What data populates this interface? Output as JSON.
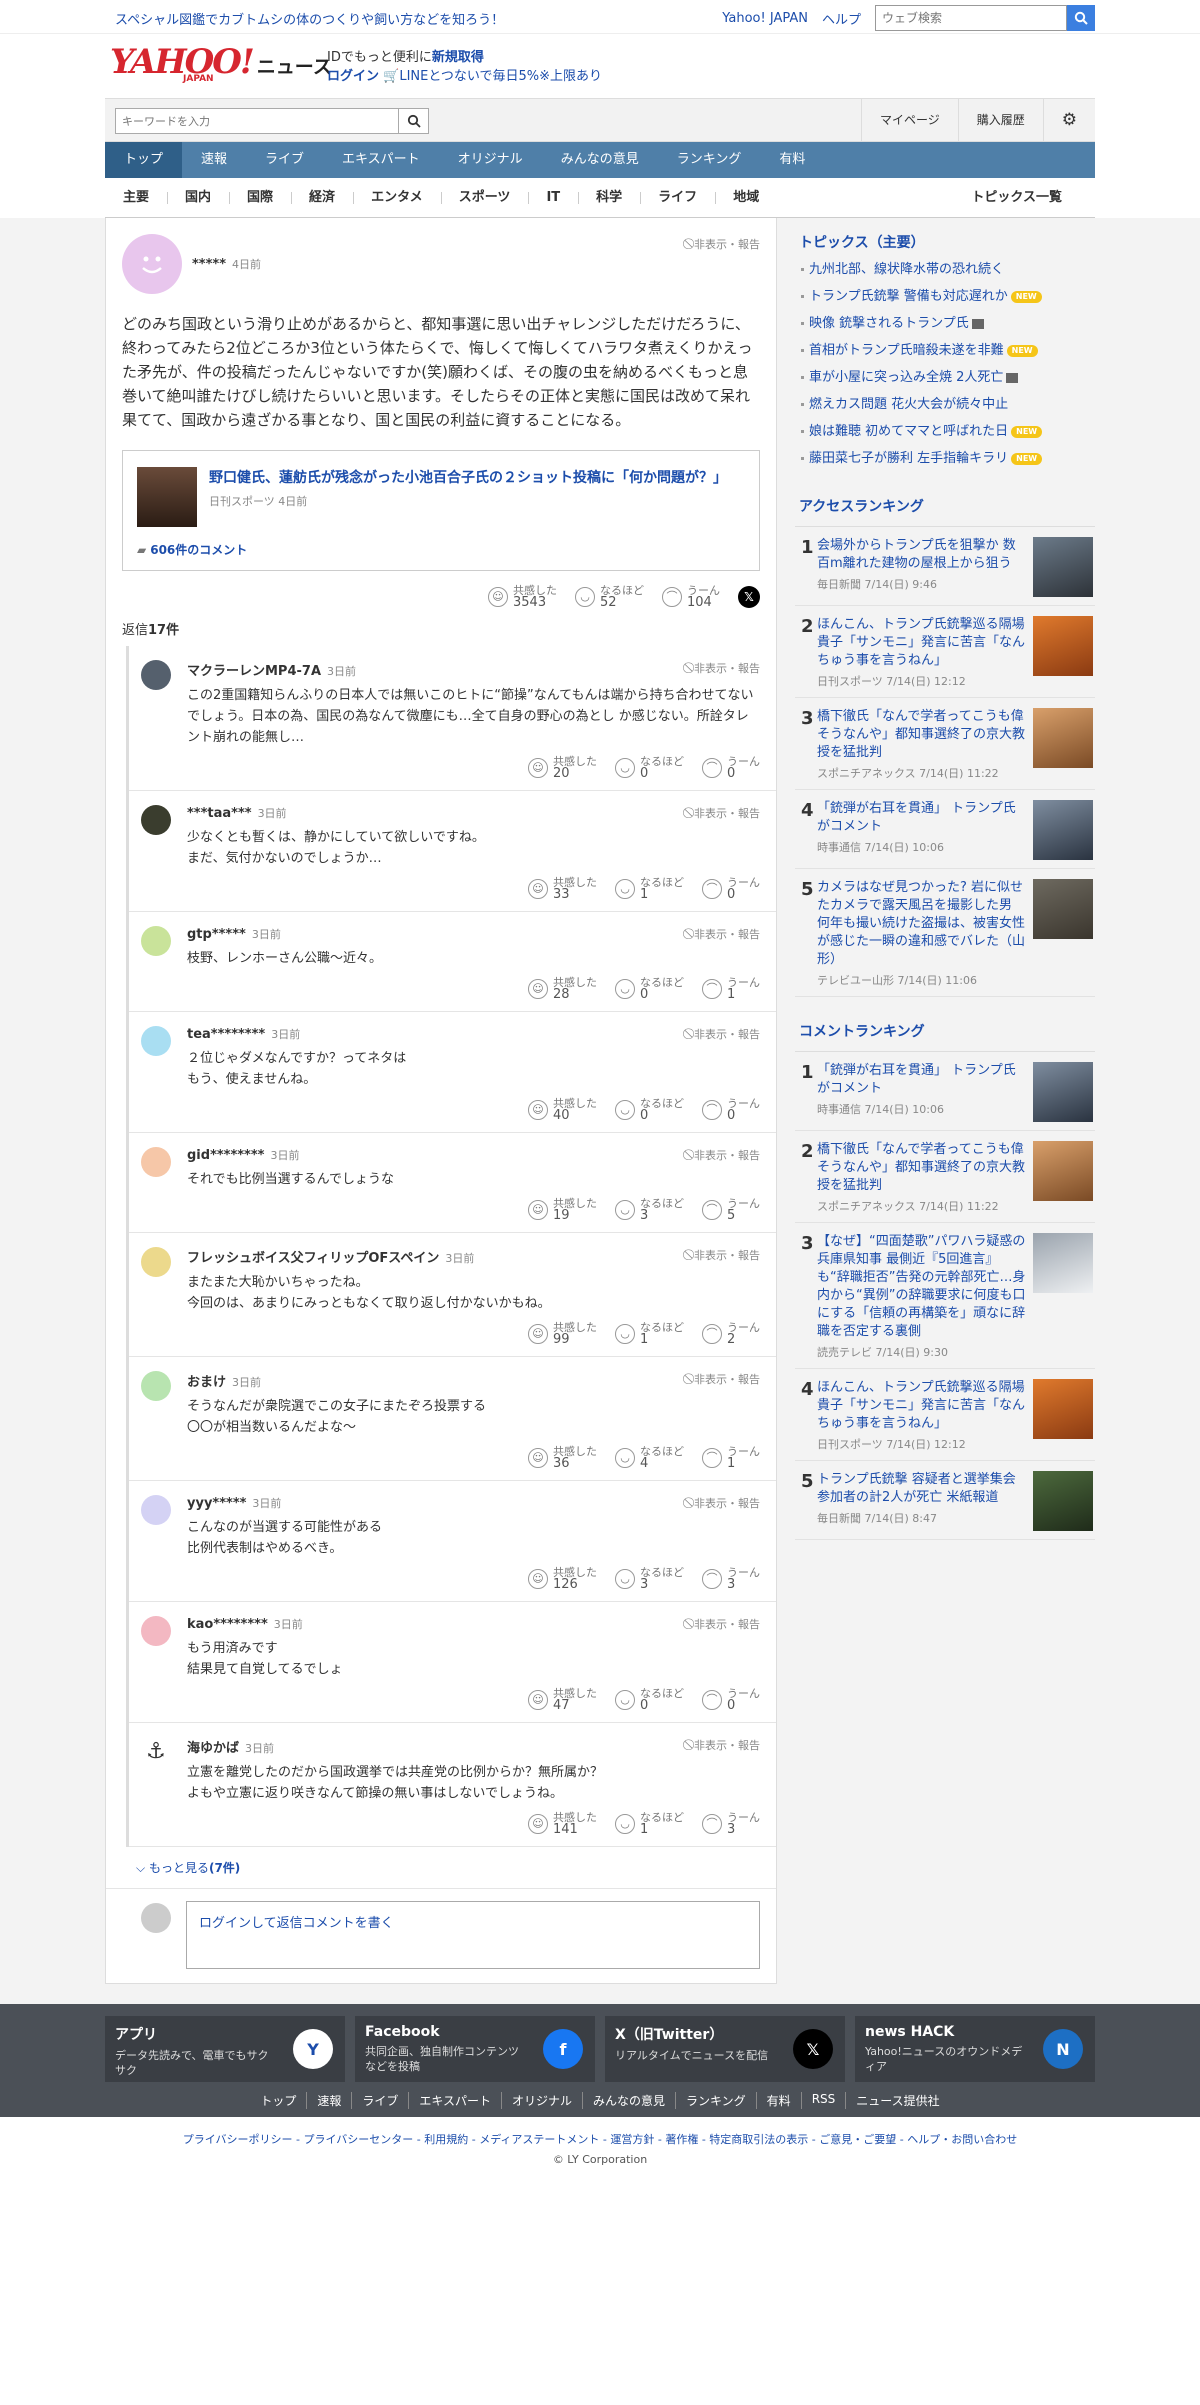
{
  "topbar": {
    "promo": "スペシャル図鑑でカブトムシの体のつくりや飼い方などを知ろう！",
    "yahoo_japan": "Yahoo! JAPAN",
    "help": "ヘルプ",
    "web_search_placeholder": "ウェブ検索"
  },
  "header": {
    "logo": "YAHOO!",
    "logo_sub": "JAPAN",
    "service": "ニュース",
    "id_line1_prefix": "IDでもっと便利に",
    "id_line1_link": "新規取得",
    "login": "ログイン",
    "line_promo": "LINEとつないで毎日5%※上限あり"
  },
  "search": {
    "placeholder": "キーワードを入力",
    "mypage": "マイページ",
    "purchase": "購入履歴"
  },
  "gnav": [
    "トップ",
    "速報",
    "ライブ",
    "エキスパート",
    "オリジナル",
    "みんなの意見",
    "ランキング",
    "有料"
  ],
  "subnav": [
    "主要",
    "国内",
    "国際",
    "経済",
    "エンタメ",
    "スポーツ",
    "IT",
    "科学",
    "ライフ",
    "地域"
  ],
  "subnav_all": "トピックス一覧",
  "comment": {
    "user": "*****",
    "time": "4日前",
    "hide": "非表示・報告",
    "body": "どのみち国政という滑り止めがあるからと、都知事選に思い出チャレンジしただけだろうに、終わってみたら2位どころか3位という体たらくで、悔しくて悔しくてハラワタ煮えくりかえった矛先が、件の投稿だったんじゃないですか(笑)願わくば、その腹の虫を納めるべくもっと息巻いて絶叫誰たけびし続けたらいいと思います。そしたらその正体と実態に国民は改めて呆れ果てて、国政から遠ざかる事となり、国と国民の利益に資することになる。",
    "article_title": "野口健氏、蓮舫氏が残念がった小池百合子氏の２ショット投稿に「何か問題が？」",
    "article_source": "日刊スポーツ 4日前",
    "article_comments": "606件のコメント",
    "react": {
      "l1": "共感した",
      "v1": "3543",
      "l2": "なるほど",
      "v2": "52",
      "l3": "うーん",
      "v3": "104"
    },
    "replies_prefix": "返信",
    "replies_count": "17件"
  },
  "replies": [
    {
      "user": "マクラーレンMP4-7A",
      "time": "3日前",
      "body": "この2重国籍知らんふりの日本人では無いこのヒトに“節操”なんてもんは端から持ち合わせてないでしょう。日本の為、国民の為なんて微塵にも…全て自身の野心の為とし か感じない。所詮タレント崩れの能無し…",
      "v1": "20",
      "v2": "0",
      "v3": "0",
      "color": "#55606d"
    },
    {
      "user": "***taa***",
      "time": "3日前",
      "body": "少なくとも暫くは、静かにしていて欲しいですね。\nまだ、気付かないのでしょうか…",
      "v1": "33",
      "v2": "1",
      "v3": "0",
      "color": "#3a3d2e"
    },
    {
      "user": "gtp*****",
      "time": "3日前",
      "body": "枝野、レンホーさん公職〜近々。",
      "v1": "28",
      "v2": "0",
      "v3": "1",
      "color": "#c9e39a"
    },
    {
      "user": "tea********",
      "time": "3日前",
      "body": "２位じゃダメなんですか？ってネタは\nもう、使えませんね。",
      "v1": "40",
      "v2": "0",
      "v3": "0",
      "color": "#a9def2"
    },
    {
      "user": "gid********",
      "time": "3日前",
      "body": "それでも比例当選するんでしょうな",
      "v1": "19",
      "v2": "3",
      "v3": "5",
      "color": "#f6c7a8"
    },
    {
      "user": "フレッシュボイス父フィリップOFスペイン",
      "time": "3日前",
      "body": "またまた大恥かいちゃったね。\n今回のは、あまりにみっともなくて取り返し付かないかもね。",
      "v1": "99",
      "v2": "1",
      "v3": "2",
      "color": "#ecd98c"
    },
    {
      "user": "おまけ",
      "time": "3日前",
      "body": "そうなんだが衆院選でこの女子にまたぞろ投票する\n〇〇が相当数いるんだよな〜",
      "v1": "36",
      "v2": "4",
      "v3": "1",
      "color": "#b8e4b0"
    },
    {
      "user": "yyy*****",
      "time": "3日前",
      "body": "こんなのが当選する可能性がある\n比例代表制はやめるべき。",
      "v1": "126",
      "v2": "3",
      "v3": "3",
      "color": "#d4d2f4"
    },
    {
      "user": "kao********",
      "time": "3日前",
      "body": "もう用済みです\n結果見て自覚してるでしょ",
      "v1": "47",
      "v2": "0",
      "v3": "0",
      "color": "#f3b8c2"
    },
    {
      "user": "海ゆかば",
      "time": "3日前",
      "body": "立憲を離党したのだから国政選挙では共産党の比例からか？無所属か？\nよもや立憲に返り咲きなんて節操の無い事はしないでしょうね。",
      "v1": "141",
      "v2": "1",
      "v3": "3",
      "color": "#ffffff"
    }
  ],
  "more": {
    "prefix": "もっと見る",
    "count": "(7件)"
  },
  "write": {
    "login": "ログイン",
    "rest": "して返信コメントを書く"
  },
  "topics": {
    "heading": "トピックス（主要）",
    "items": [
      {
        "t": "九州北部、線状降水帯の恐れ続く",
        "badge": ""
      },
      {
        "t": "トランプ氏銃撃 警備も対応遅れか",
        "badge": "NEW"
      },
      {
        "t": "映像 銃撃されるトランプ氏",
        "badge": "video"
      },
      {
        "t": "首相がトランプ氏暗殺未遂を非難",
        "badge": "NEW"
      },
      {
        "t": "車が小屋に突っ込み全焼 2人死亡",
        "badge": "video"
      },
      {
        "t": "燃えカス問題 花火大会が続々中止",
        "badge": ""
      },
      {
        "t": "娘は難聴 初めてママと呼ばれた日",
        "badge": "NEW"
      },
      {
        "t": "藤田菜七子が勝利 左手指輪キラリ",
        "badge": "NEW"
      }
    ]
  },
  "access_ranking": {
    "heading": "アクセスランキング",
    "items": [
      {
        "no": "1",
        "t": "会場外からトランプ氏を狙撃か 数百m離れた建物の屋根上から狙う",
        "m": "毎日新聞 7/14(日) 9:46"
      },
      {
        "no": "2",
        "t": "ほんこん、トランプ氏銃撃巡る隔場貴子「サンモニ」発言に苦言「なんちゅう事を言うねん」",
        "m": "日刊スポーツ 7/14(日) 12:12"
      },
      {
        "no": "3",
        "t": "橋下徹氏「なんで学者ってこうも偉そうなんや」都知事選終了の京大教授を猛批判",
        "m": "スポニチアネックス 7/14(日) 11:22"
      },
      {
        "no": "4",
        "t": "「銃弾が右耳を貫通」 トランプ氏がコメント",
        "m": "時事通信 7/14(日) 10:06"
      },
      {
        "no": "5",
        "t": "カメラはなぜ見つかった? 岩に似せたカメラで露天風呂を撮影した男 何年も撮い続けた盗撮は、被害女性が感じた一瞬の違和感でバレた（山形）",
        "m": "テレビユー山形 7/14(日) 11:06"
      }
    ]
  },
  "comment_ranking": {
    "heading": "コメントランキング",
    "items": [
      {
        "no": "1",
        "t": "「銃弾が右耳を貫通」 トランプ氏がコメント",
        "m": "時事通信 7/14(日) 10:06"
      },
      {
        "no": "2",
        "t": "橋下徹氏「なんで学者ってこうも偉そうなんや」都知事選終了の京大教授を猛批判",
        "m": "スポニチアネックス 7/14(日) 11:22"
      },
      {
        "no": "3",
        "t": "【なぜ】“四面楚歌”パワハラ疑惑の兵庫県知事 最側近『5回進言』も“辞職拒否”告発の元幹部死亡…身内から“異例”の辞職要求に何度も口にする「信頼の再構築を」頑なに辞職を否定する裏側",
        "m": "読売テレビ 7/14(日) 9:30"
      },
      {
        "no": "4",
        "t": "ほんこん、トランプ氏銃撃巡る隔場貴子「サンモニ」発言に苦言「なんちゅう事を言うねん」",
        "m": "日刊スポーツ 7/14(日) 12:12"
      },
      {
        "no": "5",
        "t": "トランプ氏銃撃 容疑者と選挙集会参加者の計2人が死亡 米紙報道",
        "m": "毎日新聞 7/14(日) 8:47"
      }
    ]
  },
  "footer": {
    "cards": [
      {
        "h": "アプリ",
        "d": "データ先読みで、電車でもサクサク",
        "icon": "yahoo-app-icon",
        "color": "#ffffff"
      },
      {
        "h": "Facebook",
        "d": "共同企画、独自制作コンテンツなどを投稿",
        "icon": "facebook-icon",
        "color": "#1877f2"
      },
      {
        "h": "X（旧Twitter）",
        "d": "リアルタイムでニュースを配信",
        "icon": "x-icon",
        "color": "#000000"
      },
      {
        "h": "news HACK",
        "d": "Yahoo!ニュースのオウンドメディア",
        "icon": "newshack-icon",
        "color": "#1d6fc4"
      }
    ],
    "links": [
      "トップ",
      "速報",
      "ライブ",
      "エキスパート",
      "オリジナル",
      "みんなの意見",
      "ランキング",
      "有料",
      "RSS",
      "ニュース提供社"
    ],
    "legal": "プライバシーポリシー - プライバシーセンター - 利用規約 - メディアステートメント - 運営方針 - 著作権 - 特定商取引法の表示 - ご意見・ご要望 - ヘルプ・お問い合わせ",
    "copyright": "© LY Corporation"
  },
  "colors": {
    "brand_red": "#d6262f",
    "link_blue": "#1c4dab",
    "nav_blue": "#4f7fa8",
    "nav_active": "#2f5f88"
  }
}
